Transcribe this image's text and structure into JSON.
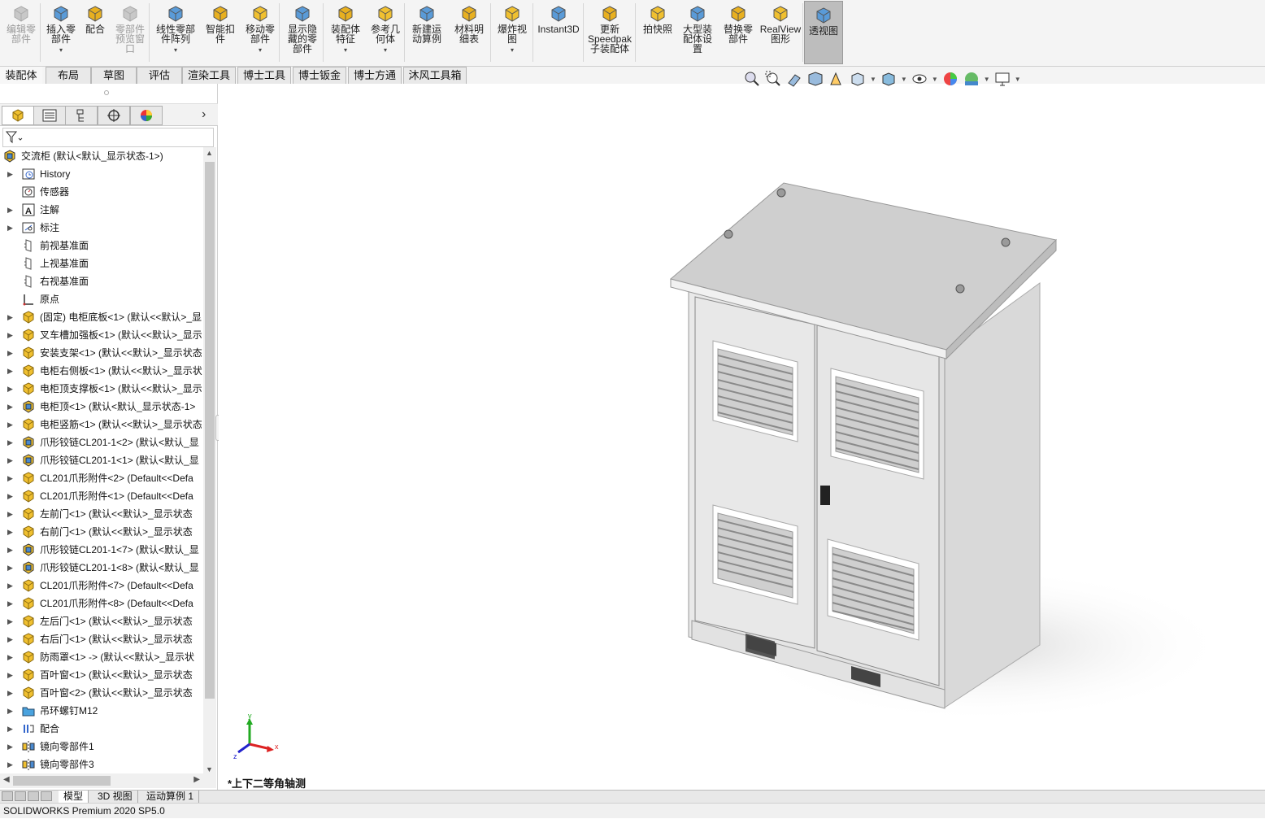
{
  "ribbon": {
    "buttons": [
      {
        "name": "edit-component-button",
        "label": "编辑零\n部件",
        "disabled": true,
        "icon": "edit-component-icon"
      },
      {
        "name": "insert-component-button",
        "label": "插入零\n部件",
        "disabled": false,
        "icon": "insert-component-icon",
        "dropdown": true
      },
      {
        "name": "mate-button",
        "label": "配合",
        "disabled": false,
        "icon": "mate-icon"
      },
      {
        "name": "component-preview-button",
        "label": "零部件\n预览窗\n口",
        "disabled": true,
        "icon": "preview-window-icon"
      },
      {
        "name": "linear-pattern-button",
        "label": "线性零部\n件阵列",
        "disabled": false,
        "icon": "linear-pattern-icon",
        "dropdown": true
      },
      {
        "name": "smart-fastener-button",
        "label": "智能扣\n件",
        "disabled": false,
        "icon": "smart-fastener-icon"
      },
      {
        "name": "move-component-button",
        "label": "移动零\n部件",
        "disabled": false,
        "icon": "move-component-icon",
        "dropdown": true
      },
      {
        "name": "show-hidden-button",
        "label": "显示隐\n藏的零\n部件",
        "disabled": false,
        "icon": "show-hidden-icon"
      },
      {
        "name": "assembly-features-button",
        "label": "装配体\n特征",
        "disabled": false,
        "icon": "assembly-feature-icon",
        "dropdown": true
      },
      {
        "name": "reference-geometry-button",
        "label": "参考几\n何体",
        "disabled": false,
        "icon": "reference-geometry-icon",
        "dropdown": true
      },
      {
        "name": "new-motion-study-button",
        "label": "新建运\n动算例",
        "disabled": false,
        "icon": "motion-study-icon"
      },
      {
        "name": "bom-button",
        "label": "材料明\n细表",
        "disabled": false,
        "icon": "bom-icon"
      },
      {
        "name": "exploded-view-button",
        "label": "爆炸视\n图",
        "disabled": false,
        "icon": "exploded-view-icon",
        "dropdown": true
      },
      {
        "name": "instant3d-button",
        "label": "Instant3D",
        "disabled": false,
        "icon": "instant3d-icon"
      },
      {
        "name": "update-speedpak-button",
        "label": "更新\nSpeedpak\n子装配体",
        "disabled": false,
        "icon": "speedpak-icon"
      },
      {
        "name": "snapshot-button",
        "label": "拍快照",
        "disabled": false,
        "icon": "camera-icon"
      },
      {
        "name": "large-assembly-button",
        "label": "大型装\n配体设\n置",
        "disabled": false,
        "icon": "large-assembly-icon"
      },
      {
        "name": "replace-component-button",
        "label": "替换零\n部件",
        "disabled": false,
        "icon": "replace-component-icon"
      },
      {
        "name": "realview-button",
        "label": "RealView\n图形",
        "disabled": false,
        "icon": "realview-icon"
      },
      {
        "name": "perspective-button",
        "label": "透视图",
        "disabled": false,
        "icon": "perspective-icon",
        "active": true
      }
    ]
  },
  "tabs": [
    "装配体",
    "布局",
    "草图",
    "评估",
    "渲染工具",
    "博士工具",
    "博士钣金",
    "博士方通",
    "沐风工具箱"
  ],
  "tree": {
    "root": "交流柜  (默认<默认_显示状态-1>)",
    "items": [
      {
        "label": "History",
        "icon": "history-icon",
        "expand": true
      },
      {
        "label": "传感器",
        "icon": "sensor-icon",
        "expand": false
      },
      {
        "label": "注解",
        "icon": "annotation-icon",
        "expand": true
      },
      {
        "label": "标注",
        "icon": "dimension-icon",
        "expand": true
      },
      {
        "label": "前视基准面",
        "icon": "plane-icon",
        "expand": false
      },
      {
        "label": "上视基准面",
        "icon": "plane-icon",
        "expand": false
      },
      {
        "label": "右视基准面",
        "icon": "plane-icon",
        "expand": false
      },
      {
        "label": "原点",
        "icon": "origin-icon",
        "expand": false
      },
      {
        "label": "(固定) 电柜底板<1> (默认<<默认>_显",
        "icon": "part-icon",
        "expand": true
      },
      {
        "label": "叉车槽加强板<1> (默认<<默认>_显示",
        "icon": "part-icon",
        "expand": true
      },
      {
        "label": "安装支架<1> (默认<<默认>_显示状态",
        "icon": "part-icon",
        "expand": true
      },
      {
        "label": "电柜右侧板<1> (默认<<默认>_显示状",
        "icon": "part-icon",
        "expand": true
      },
      {
        "label": "电柜顶支撑板<1> (默认<<默认>_显示",
        "icon": "part-icon",
        "expand": true
      },
      {
        "label": "电柜顶<1> (默认<默认_显示状态-1>",
        "icon": "subassembly-icon",
        "expand": true
      },
      {
        "label": "电柜竖筋<1> (默认<<默认>_显示状态",
        "icon": "part-icon",
        "expand": true
      },
      {
        "label": "爪形铰链CL201-1<2> (默认<默认_显",
        "icon": "subassembly-icon",
        "expand": true
      },
      {
        "label": "爪形铰链CL201-1<1> (默认<默认_显",
        "icon": "subassembly-icon",
        "expand": true
      },
      {
        "label": "CL201爪形附件<2> (Default<<Defa",
        "icon": "part-icon",
        "expand": true
      },
      {
        "label": "CL201爪形附件<1> (Default<<Defa",
        "icon": "part-icon",
        "expand": true
      },
      {
        "label": "左前门<1> (默认<<默认>_显示状态",
        "icon": "part-icon",
        "expand": true
      },
      {
        "label": "右前门<1> (默认<<默认>_显示状态",
        "icon": "part-icon",
        "expand": true
      },
      {
        "label": "爪形铰链CL201-1<7> (默认<默认_显",
        "icon": "subassembly-icon",
        "expand": true
      },
      {
        "label": "爪形铰链CL201-1<8> (默认<默认_显",
        "icon": "subassembly-icon",
        "expand": true
      },
      {
        "label": "CL201爪形附件<7> (Default<<Defa",
        "icon": "part-icon",
        "expand": true
      },
      {
        "label": "CL201爪形附件<8> (Default<<Defa",
        "icon": "part-icon",
        "expand": true
      },
      {
        "label": "左后门<1> (默认<<默认>_显示状态",
        "icon": "part-icon",
        "expand": true
      },
      {
        "label": "右后门<1> (默认<<默认>_显示状态",
        "icon": "part-icon",
        "expand": true
      },
      {
        "label": "防雨罩<1> -> (默认<<默认>_显示状",
        "icon": "part-icon",
        "expand": true
      },
      {
        "label": "百叶窗<1> (默认<<默认>_显示状态",
        "icon": "part-icon",
        "expand": true
      },
      {
        "label": "百叶窗<2> (默认<<默认>_显示状态",
        "icon": "part-icon",
        "expand": true
      },
      {
        "label": "吊环螺钉M12",
        "icon": "folder-icon",
        "expand": true
      },
      {
        "label": "配合",
        "icon": "mates-icon",
        "expand": true
      },
      {
        "label": "镜向零部件1",
        "icon": "mirror-component-icon",
        "expand": true
      },
      {
        "label": "镜向零部件3",
        "icon": "mirror-component-icon",
        "expand": true
      }
    ]
  },
  "viewport": {
    "view_label": "*上下二等角轴测",
    "axis_x": "x",
    "axis_y": "y",
    "axis_z": "z"
  },
  "bottom_tabs": [
    "模型",
    "3D 视图",
    "运动算例 1"
  ],
  "status": "SOLIDWORKS Premium 2020 SP5.0",
  "colors": {
    "part": "#f0c030",
    "accent": "#1a64b4",
    "cabinet": "#e6e6e6"
  }
}
